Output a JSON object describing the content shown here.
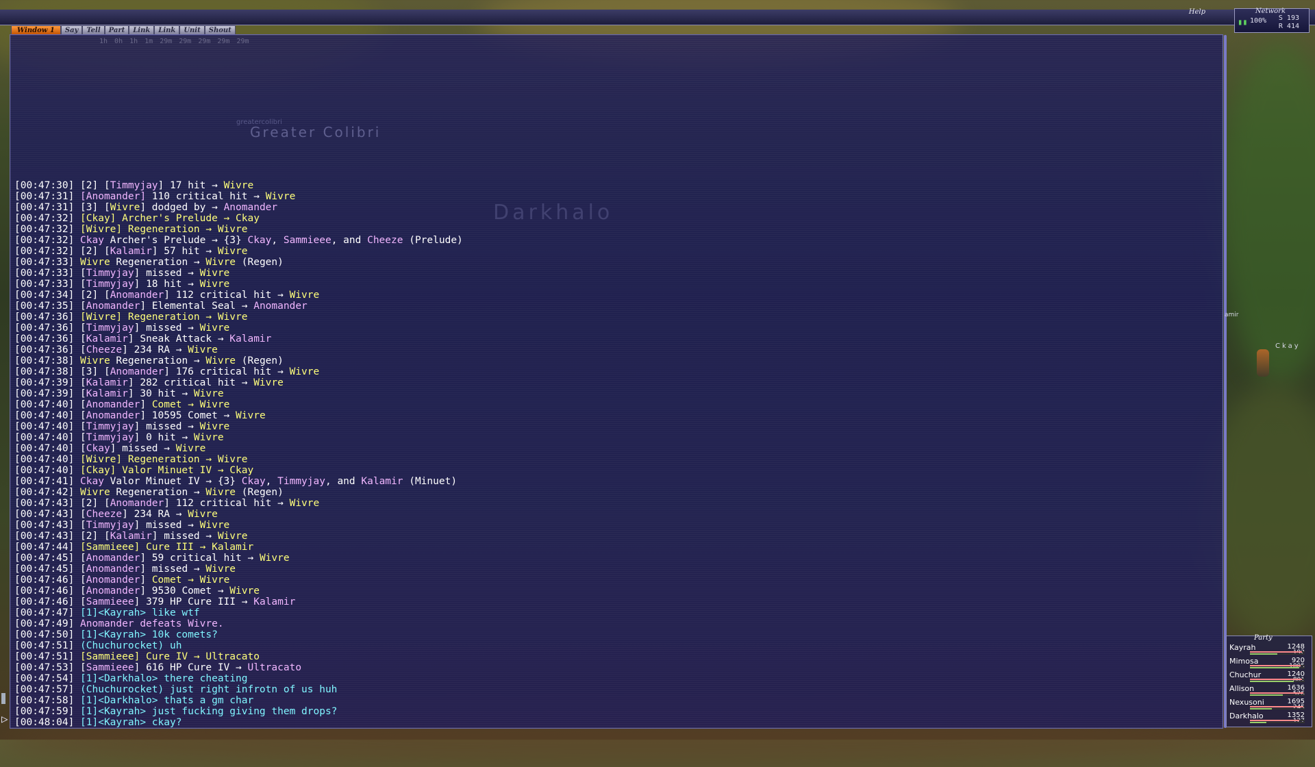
{
  "colors": {
    "accent": "#ff8a2a",
    "chat_bg": "#1c1a5c",
    "name": "#f1b6ff",
    "ability": "#ffff7a",
    "linkshell": "#7ff5ff"
  },
  "topbar": {
    "help_label": "Help",
    "network": {
      "title": "Network",
      "percent": "100%",
      "send": "S 193",
      "recv": "R 414"
    }
  },
  "chat_tabs": [
    {
      "label": "Window 1",
      "active": true
    },
    {
      "label": "Say"
    },
    {
      "label": "Tell"
    },
    {
      "label": "Part"
    },
    {
      "label": "Link"
    },
    {
      "label": "Link"
    },
    {
      "label": "Unit"
    },
    {
      "label": "Shout"
    }
  ],
  "overlay": {
    "enemy_name_small": "greatercolibri",
    "enemy_name": "Greater Colibri",
    "player_name": "Darkhalo",
    "buff_timers": [
      "1h",
      "0h",
      "1h",
      "1m",
      "29m",
      "29m",
      "29m",
      "29m",
      "29m"
    ]
  },
  "chat_log": [
    [
      [
        "c-white",
        "[00:47:30] [2] ["
      ],
      [
        "c-pink",
        "Timmyjay"
      ],
      [
        "c-white",
        "] 17 hit → "
      ],
      [
        "c-yellow",
        "Wivre"
      ]
    ],
    [
      [
        "c-white",
        "[00:47:31] "
      ],
      [
        "c-pink",
        "["
      ],
      [
        "c-pink",
        "Anomander"
      ],
      [
        "c-pink",
        "]"
      ],
      [
        "c-white",
        " 110 critical hit → "
      ],
      [
        "c-yellow",
        "Wivre"
      ]
    ],
    [
      [
        "c-white",
        "[00:47:31] [3] ["
      ],
      [
        "c-yellow",
        "Wivre"
      ],
      [
        "c-white",
        "] dodged by → "
      ],
      [
        "c-pink",
        "Anomander"
      ]
    ],
    [
      [
        "c-white",
        "[00:47:32] "
      ],
      [
        "c-yellow",
        "[Ckay] Archer's Prelude → Ckay"
      ]
    ],
    [
      [
        "c-white",
        "[00:47:32] "
      ],
      [
        "c-yellow",
        "[Wivre] Regeneration → Wivre"
      ]
    ],
    [
      [
        "c-white",
        "[00:47:32] "
      ],
      [
        "c-pink",
        "Ckay"
      ],
      [
        "c-white",
        " Archer's Prelude → {3} "
      ],
      [
        "c-pink",
        "Ckay"
      ],
      [
        "c-white",
        ", "
      ],
      [
        "c-pink",
        "Sammieee"
      ],
      [
        "c-white",
        ", and "
      ],
      [
        "c-pink",
        "Cheeze"
      ],
      [
        "c-white",
        " (Prelude)"
      ]
    ],
    [
      [
        "c-white",
        "[00:47:32] [2] ["
      ],
      [
        "c-pink",
        "Kalamir"
      ],
      [
        "c-white",
        "] 57 hit → "
      ],
      [
        "c-yellow",
        "Wivre"
      ]
    ],
    [
      [
        "c-white",
        "[00:47:33] "
      ],
      [
        "c-yellow",
        "Wivre"
      ],
      [
        "c-white",
        " Regeneration → "
      ],
      [
        "c-yellow",
        "Wivre"
      ],
      [
        "c-white",
        " (Regen)"
      ]
    ],
    [
      [
        "c-white",
        "[00:47:33] ["
      ],
      [
        "c-pink",
        "Timmyjay"
      ],
      [
        "c-white",
        "] missed → "
      ],
      [
        "c-yellow",
        "Wivre"
      ]
    ],
    [
      [
        "c-white",
        "[00:47:33] ["
      ],
      [
        "c-pink",
        "Timmyjay"
      ],
      [
        "c-white",
        "] 18 hit → "
      ],
      [
        "c-yellow",
        "Wivre"
      ]
    ],
    [
      [
        "c-white",
        "[00:47:34] [2] ["
      ],
      [
        "c-pink",
        "Anomander"
      ],
      [
        "c-white",
        "] 112 critical hit → "
      ],
      [
        "c-yellow",
        "Wivre"
      ]
    ],
    [
      [
        "c-white",
        "[00:47:35] ["
      ],
      [
        "c-pink",
        "Anomander"
      ],
      [
        "c-white",
        "] Elemental Seal → "
      ],
      [
        "c-pink",
        "Anomander"
      ]
    ],
    [
      [
        "c-white",
        "[00:47:36] "
      ],
      [
        "c-yellow",
        "[Wivre] Regeneration → Wivre"
      ]
    ],
    [
      [
        "c-white",
        "[00:47:36] ["
      ],
      [
        "c-pink",
        "Timmyjay"
      ],
      [
        "c-white",
        "] missed → "
      ],
      [
        "c-yellow",
        "Wivre"
      ]
    ],
    [
      [
        "c-white",
        "[00:47:36] ["
      ],
      [
        "c-pink",
        "Kalamir"
      ],
      [
        "c-white",
        "] Sneak Attack → "
      ],
      [
        "c-pink",
        "Kalamir"
      ]
    ],
    [
      [
        "c-white",
        "[00:47:36] ["
      ],
      [
        "c-pink",
        "Cheeze"
      ],
      [
        "c-white",
        "] 234 RA → "
      ],
      [
        "c-yellow",
        "Wivre"
      ]
    ],
    [
      [
        "c-white",
        "[00:47:38] "
      ],
      [
        "c-yellow",
        "Wivre"
      ],
      [
        "c-white",
        " Regeneration → "
      ],
      [
        "c-yellow",
        "Wivre"
      ],
      [
        "c-white",
        " (Regen)"
      ]
    ],
    [
      [
        "c-white",
        "[00:47:38] [3] ["
      ],
      [
        "c-pink",
        "Anomander"
      ],
      [
        "c-white",
        "] 176 critical hit → "
      ],
      [
        "c-yellow",
        "Wivre"
      ]
    ],
    [
      [
        "c-white",
        "[00:47:39] ["
      ],
      [
        "c-pink",
        "Kalamir"
      ],
      [
        "c-white",
        "] 282 critical hit → "
      ],
      [
        "c-yellow",
        "Wivre"
      ]
    ],
    [
      [
        "c-white",
        "[00:47:39] ["
      ],
      [
        "c-pink",
        "Kalamir"
      ],
      [
        "c-white",
        "] 30 hit → "
      ],
      [
        "c-yellow",
        "Wivre"
      ]
    ],
    [
      [
        "c-white",
        "[00:47:40] ["
      ],
      [
        "c-pink",
        "Anomander"
      ],
      [
        "c-white",
        "] "
      ],
      [
        "c-yellow",
        "Comet → Wivre"
      ]
    ],
    [
      [
        "c-white",
        "[00:47:40] ["
      ],
      [
        "c-pink",
        "Anomander"
      ],
      [
        "c-white",
        "] 10595 Comet → "
      ],
      [
        "c-yellow",
        "Wivre"
      ]
    ],
    [
      [
        "c-white",
        "[00:47:40] ["
      ],
      [
        "c-pink",
        "Timmyjay"
      ],
      [
        "c-white",
        "] missed → "
      ],
      [
        "c-yellow",
        "Wivre"
      ]
    ],
    [
      [
        "c-white",
        "[00:47:40] ["
      ],
      [
        "c-pink",
        "Timmyjay"
      ],
      [
        "c-white",
        "] 0 hit → "
      ],
      [
        "c-yellow",
        "Wivre"
      ]
    ],
    [
      [
        "c-white",
        "[00:47:40] ["
      ],
      [
        "c-pink",
        "Ckay"
      ],
      [
        "c-white",
        "] missed → "
      ],
      [
        "c-yellow",
        "Wivre"
      ]
    ],
    [
      [
        "c-white",
        "[00:47:40] "
      ],
      [
        "c-yellow",
        "[Wivre] Regeneration → Wivre"
      ]
    ],
    [
      [
        "c-white",
        "[00:47:40] "
      ],
      [
        "c-yellow",
        "[Ckay] Valor Minuet IV → Ckay"
      ]
    ],
    [
      [
        "c-white",
        "[00:47:41] "
      ],
      [
        "c-pink",
        "Ckay"
      ],
      [
        "c-white",
        " Valor Minuet IV → {3} "
      ],
      [
        "c-pink",
        "Ckay"
      ],
      [
        "c-white",
        ", "
      ],
      [
        "c-pink",
        "Timmyjay"
      ],
      [
        "c-white",
        ", and "
      ],
      [
        "c-pink",
        "Kalamir"
      ],
      [
        "c-white",
        " (Minuet)"
      ]
    ],
    [
      [
        "c-white",
        "[00:47:42] "
      ],
      [
        "c-yellow",
        "Wivre"
      ],
      [
        "c-white",
        " Regeneration → "
      ],
      [
        "c-yellow",
        "Wivre"
      ],
      [
        "c-white",
        " (Regen)"
      ]
    ],
    [
      [
        "c-white",
        "[00:47:43] [2] ["
      ],
      [
        "c-pink",
        "Anomander"
      ],
      [
        "c-white",
        "] 112 critical hit → "
      ],
      [
        "c-yellow",
        "Wivre"
      ]
    ],
    [
      [
        "c-white",
        "[00:47:43] ["
      ],
      [
        "c-pink",
        "Cheeze"
      ],
      [
        "c-white",
        "] 234 RA → "
      ],
      [
        "c-yellow",
        "Wivre"
      ]
    ],
    [
      [
        "c-white",
        "[00:47:43] ["
      ],
      [
        "c-pink",
        "Timmyjay"
      ],
      [
        "c-white",
        "] missed → "
      ],
      [
        "c-yellow",
        "Wivre"
      ]
    ],
    [
      [
        "c-white",
        "[00:47:43] [2] ["
      ],
      [
        "c-pink",
        "Kalamir"
      ],
      [
        "c-white",
        "] missed → "
      ],
      [
        "c-yellow",
        "Wivre"
      ]
    ],
    [
      [
        "c-white",
        "[00:47:44] "
      ],
      [
        "c-yellow",
        "[Sammieee] Cure III → Kalamir"
      ]
    ],
    [
      [
        "c-white",
        "[00:47:45] ["
      ],
      [
        "c-pink",
        "Anomander"
      ],
      [
        "c-white",
        "] 59 critical hit → "
      ],
      [
        "c-yellow",
        "Wivre"
      ]
    ],
    [
      [
        "c-white",
        "[00:47:45] ["
      ],
      [
        "c-pink",
        "Anomander"
      ],
      [
        "c-white",
        "] missed → "
      ],
      [
        "c-yellow",
        "Wivre"
      ]
    ],
    [
      [
        "c-white",
        "[00:47:46] ["
      ],
      [
        "c-pink",
        "Anomander"
      ],
      [
        "c-white",
        "] "
      ],
      [
        "c-yellow",
        "Comet → Wivre"
      ]
    ],
    [
      [
        "c-white",
        "[00:47:46] ["
      ],
      [
        "c-pink",
        "Anomander"
      ],
      [
        "c-white",
        "] 9530 Comet → "
      ],
      [
        "c-yellow",
        "Wivre"
      ]
    ],
    [
      [
        "c-white",
        "[00:47:46] ["
      ],
      [
        "c-pink",
        "Sammieee"
      ],
      [
        "c-white",
        "] 379 HP Cure III → "
      ],
      [
        "c-pink",
        "Kalamir"
      ]
    ],
    [
      [
        "c-white",
        "[00:47:47] "
      ],
      [
        "c-cyan",
        "[1]<Kayrah> like wtf"
      ]
    ],
    [
      [
        "c-white",
        "[00:47:49] "
      ],
      [
        "c-pink",
        "Anomander defeats Wivre."
      ]
    ],
    [
      [
        "c-white",
        "[00:47:50] "
      ],
      [
        "c-cyan",
        "[1]<Kayrah> 10k comets?"
      ]
    ],
    [
      [
        "c-white",
        "[00:47:51] "
      ],
      [
        "c-cyan",
        "(Chuchurocket) uh"
      ]
    ],
    [
      [
        "c-white",
        "[00:47:51] "
      ],
      [
        "c-yellow",
        "[Sammieee] Cure IV → Ultracato"
      ]
    ],
    [
      [
        "c-white",
        "[00:47:53] ["
      ],
      [
        "c-pink",
        "Sammieee"
      ],
      [
        "c-white",
        "] 616 HP Cure IV → "
      ],
      [
        "c-pink",
        "Ultracato"
      ]
    ],
    [
      [
        "c-white",
        "[00:47:54] "
      ],
      [
        "c-cyan",
        "[1]<Darkhalo> there cheating"
      ]
    ],
    [
      [
        "c-white",
        "[00:47:57] "
      ],
      [
        "c-cyan",
        "(Chuchurocket) just right infrotn of us huh"
      ]
    ],
    [
      [
        "c-white",
        "[00:47:58] "
      ],
      [
        "c-cyan",
        "[1]<Darkhalo> thats a gm char"
      ]
    ],
    [
      [
        "c-white",
        "[00:47:59] "
      ],
      [
        "c-cyan",
        "[1]<Kayrah> just fucking giving them drops?"
      ]
    ],
    [
      [
        "c-white",
        "[00:48:04] "
      ],
      [
        "c-cyan",
        "[1]<Kayrah> ckay?"
      ]
    ]
  ],
  "world_labels": {
    "ckay": "Ckay",
    "partial": "amir"
  },
  "party": {
    "title": "Party",
    "members": [
      {
        "name": "Kayrah",
        "hp": "1248",
        "mp": "192",
        "hp_pct": 0.95,
        "mp_pct": 0.5
      },
      {
        "name": "Mimosa",
        "hp": "920",
        "mp": "1005",
        "hp_pct": 0.92,
        "mp_pct": 0.9
      },
      {
        "name": "Chuchur",
        "hp": "1240",
        "mp": "801",
        "hp_pct": 0.95,
        "mp_pct": 0.8
      },
      {
        "name": "Allison",
        "hp": "1636",
        "mp": "526",
        "hp_pct": 0.98,
        "mp_pct": 0.6
      },
      {
        "name": "Nexusoni",
        "hp": "1695",
        "mp": "245",
        "hp_pct": 0.97,
        "mp_pct": 0.4
      },
      {
        "name": "Darkhalo",
        "hp": "1352",
        "mp": "127",
        "hp_pct": 0.9,
        "mp_pct": 0.3
      }
    ]
  }
}
